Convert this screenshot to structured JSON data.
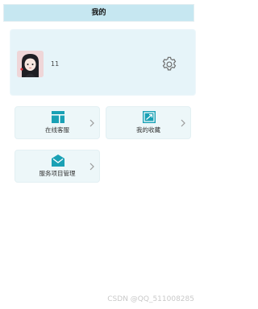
{
  "header": {
    "title": "我的"
  },
  "profile": {
    "username": "11",
    "avatar_icon": "avatar-girl-icon",
    "settings_icon": "gear-icon"
  },
  "menu": [
    {
      "label": "在线客服",
      "icon": "layout-icon"
    },
    {
      "label": "我的收藏",
      "icon": "collect-icon"
    },
    {
      "label": "服务项目管理",
      "icon": "envelope-icon"
    }
  ],
  "watermark": "CSDN @QQ_511008285",
  "colors": {
    "header_bg": "#c6e7f1",
    "card_bg": "#e6f4f9",
    "tile_bg": "#edf7f9",
    "icon_teal": "#1aa1b5"
  }
}
